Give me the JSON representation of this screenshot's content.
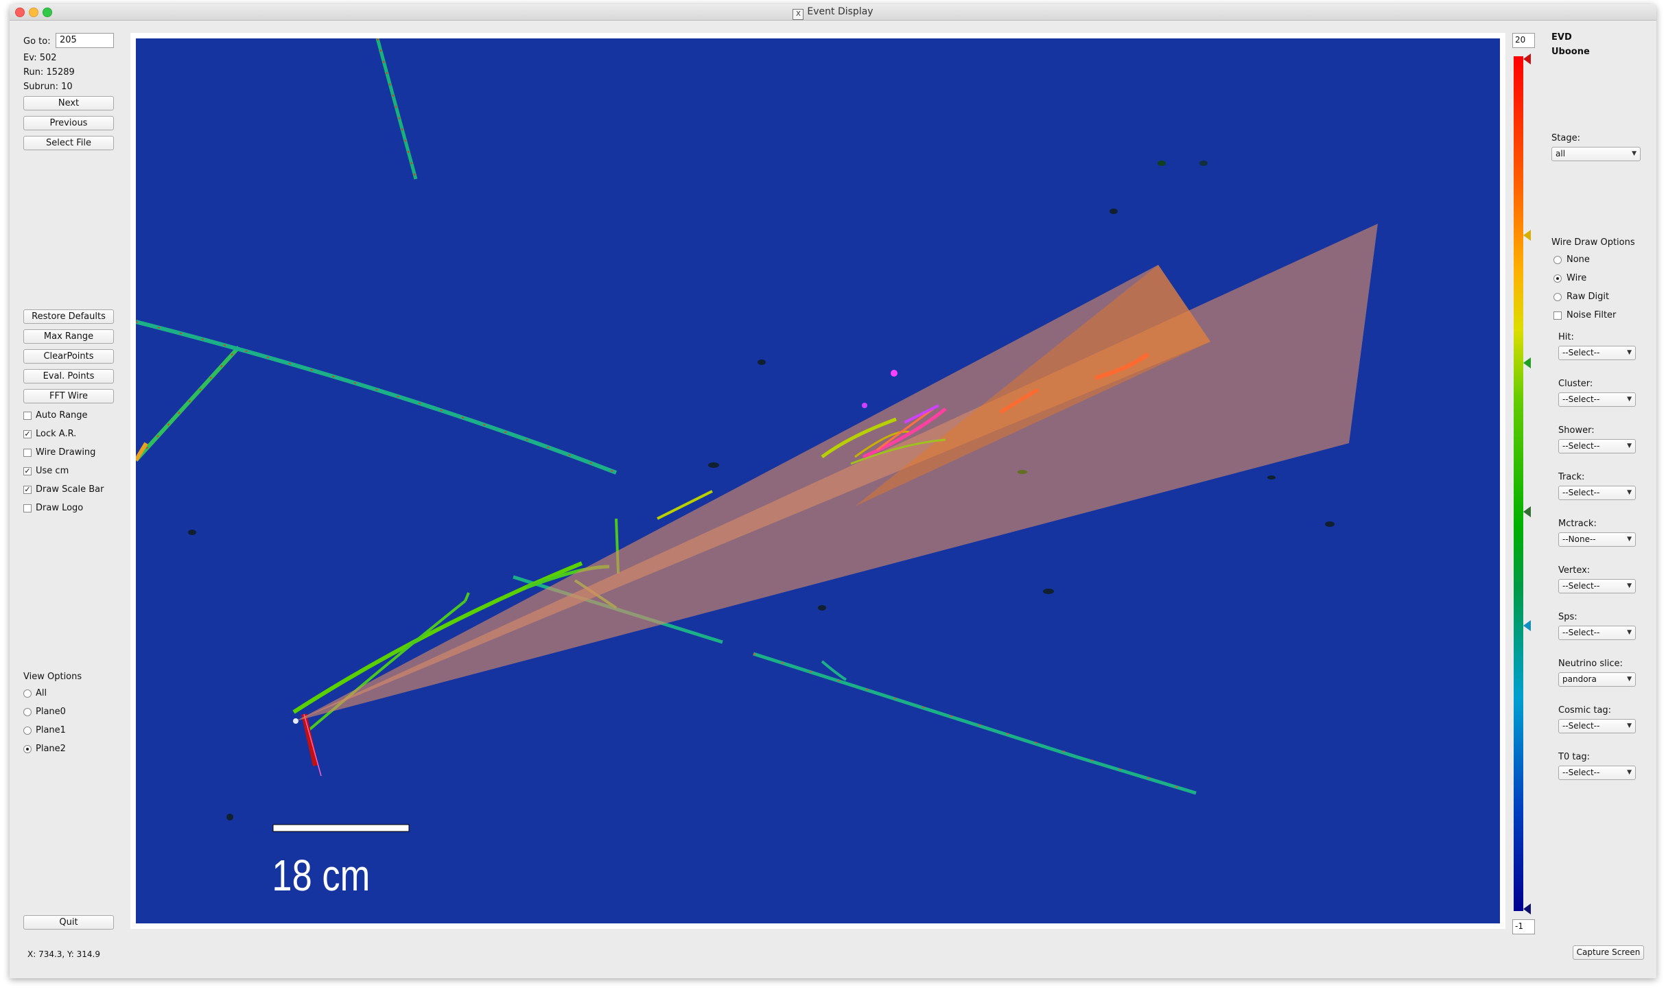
{
  "window": {
    "title": "Event Display"
  },
  "left_panel": {
    "goto_label": "Go to:",
    "goto_value": "205",
    "ev": "Ev: 502",
    "run": "Run: 15289",
    "subrun": "Subrun: 10",
    "buttons": {
      "next": "Next",
      "previous": "Previous",
      "select_file": "Select File",
      "restore_defaults": "Restore Defaults",
      "max_range": "Max Range",
      "clear_points": "ClearPoints",
      "eval_points": "Eval. Points",
      "fft_wire": "FFT Wire",
      "quit": "Quit"
    },
    "checkboxes": [
      {
        "label": "Auto Range",
        "checked": false
      },
      {
        "label": "Lock A.R.",
        "checked": true
      },
      {
        "label": "Wire Drawing",
        "checked": false
      },
      {
        "label": "Use cm",
        "checked": true
      },
      {
        "label": "Draw Scale Bar",
        "checked": true
      },
      {
        "label": "Draw Logo",
        "checked": false
      }
    ],
    "view_options_label": "View Options",
    "view_options": [
      {
        "label": "All",
        "selected": false
      },
      {
        "label": "Plane0",
        "selected": false
      },
      {
        "label": "Plane1",
        "selected": false
      },
      {
        "label": "Plane2",
        "selected": true
      }
    ]
  },
  "display": {
    "scale_bar_label": "18 cm",
    "background_color": "#1534a0",
    "cone_color": "#d88a66"
  },
  "colorbar": {
    "max_value": "20",
    "min_value": "-1"
  },
  "right_panel": {
    "app_title": "EVD",
    "experiment": "Uboone",
    "stage_label": "Stage:",
    "stage_value": "all",
    "wire_draw_label": "Wire Draw Options",
    "wire_draw_options": [
      {
        "label": "None",
        "selected": false
      },
      {
        "label": "Wire",
        "selected": true
      },
      {
        "label": "Raw Digit",
        "selected": false
      }
    ],
    "noise_filter": {
      "label": "Noise Filter",
      "checked": false
    },
    "dropdowns": [
      {
        "label": "Hit:",
        "value": "--Select--"
      },
      {
        "label": "Cluster:",
        "value": "--Select--"
      },
      {
        "label": "Shower:",
        "value": "--Select--"
      },
      {
        "label": "Track:",
        "value": "--Select--"
      },
      {
        "label": "Mctrack:",
        "value": "--None--"
      },
      {
        "label": "Vertex:",
        "value": "--Select--"
      },
      {
        "label": "Sps:",
        "value": "--Select--"
      },
      {
        "label": "Neutrino slice:",
        "value": "pandora"
      },
      {
        "label": "Cosmic tag:",
        "value": "--Select--"
      },
      {
        "label": "T0 tag:",
        "value": "--Select--"
      }
    ]
  },
  "status": {
    "coords": "X: 734.3, Y: 314.9",
    "capture_button": "Capture Screen"
  }
}
